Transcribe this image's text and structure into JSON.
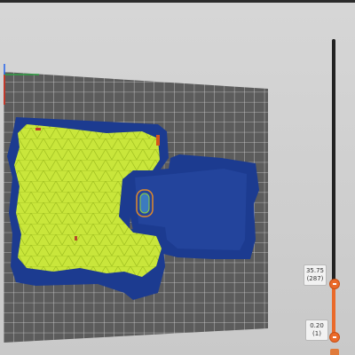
{
  "colors": {
    "background": "#cfcfcf",
    "bed_plate": "#5a5a5a",
    "grid_line": "#d4d4d4",
    "perimeter": "#1b3a8f",
    "infill": "#c8e63a",
    "slider_accent": "#ea6a2a",
    "slider_track": "#222222"
  },
  "layer_slider": {
    "top_height": "35.75",
    "top_layer": "(287)",
    "bottom_height": "0.20",
    "bottom_layer": "(1)"
  },
  "icons": {
    "axis": "axis-gizmo-icon",
    "bottom": "legend-toggle-icon"
  }
}
